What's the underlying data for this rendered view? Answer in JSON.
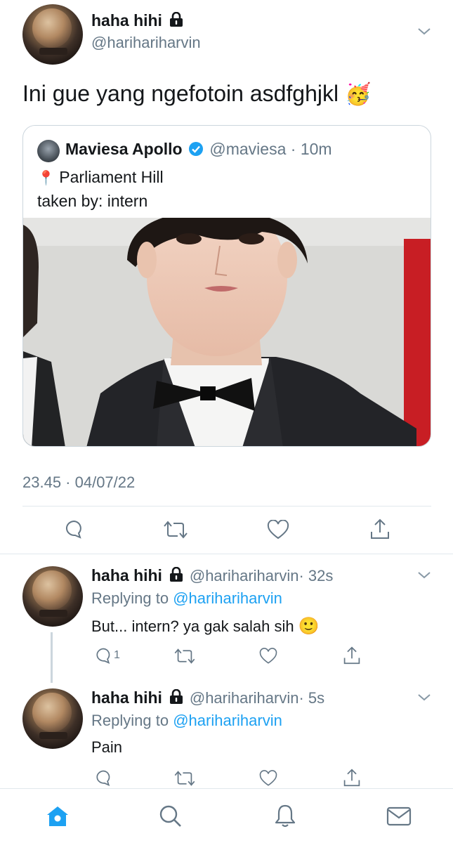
{
  "main_tweet": {
    "name": "haha hihi",
    "handle": "@harihariharvin",
    "text": "Ini gue yang ngefotoin asdfghjkl",
    "emoji": "🥳",
    "timestamp": "23.45 · 04/07/22"
  },
  "quoted_tweet": {
    "name": "Maviesa Apollo",
    "handle": "@maviesa",
    "time": "· 10m",
    "location_pin": "📍",
    "location": "Parliament Hill",
    "caption": "taken by: intern"
  },
  "replies": [
    {
      "name": "haha hihi",
      "handle": "@harihariharvin",
      "time": "· 32s",
      "replying_prefix": "Replying to",
      "replying_handle": "@harihariharvin",
      "text": "But... intern? ya gak salah sih",
      "emoji": "🙂",
      "reply_count": "1"
    },
    {
      "name": "haha hihi",
      "handle": "@harihariharvin",
      "time": "· 5s",
      "replying_prefix": "Replying to",
      "replying_handle": "@harihariharvin",
      "text": "Pain",
      "emoji": "",
      "reply_count": ""
    }
  ],
  "icons": {
    "tab_bar": [
      "home-icon",
      "search-icon",
      "bell-icon",
      "mail-icon"
    ],
    "actions": [
      "reply-icon",
      "retweet-icon",
      "like-icon",
      "share-icon"
    ]
  },
  "colors": {
    "accent": "#1da1f2",
    "text": "#14171a",
    "secondary": "#657786",
    "divider": "#e1e8ed"
  }
}
